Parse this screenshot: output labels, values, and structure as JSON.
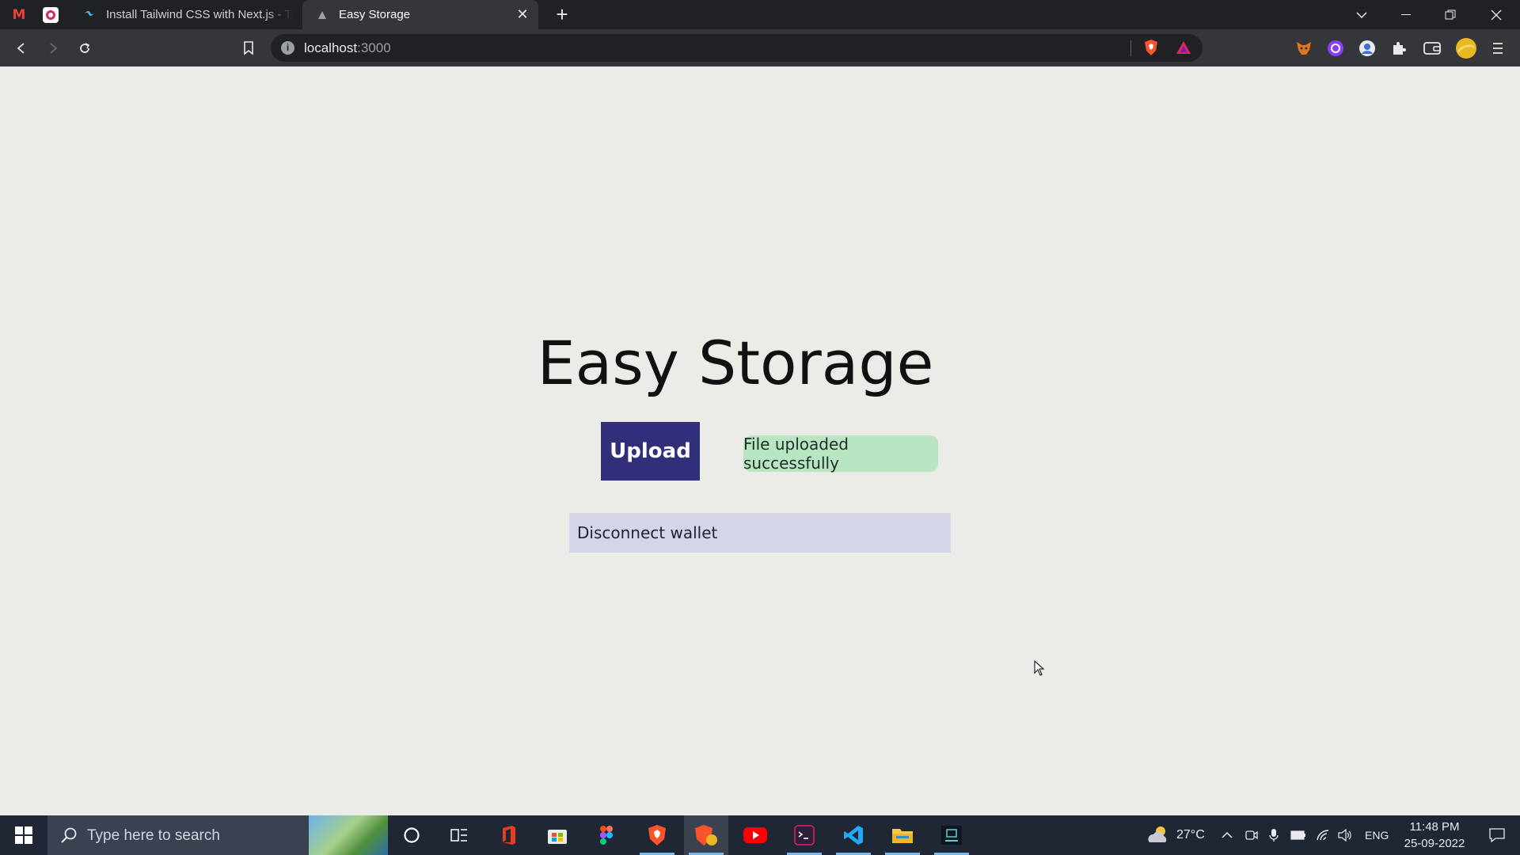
{
  "browser": {
    "tabs": [
      {
        "title": "Install Tailwind CSS with Next.js - Tailwind CSS",
        "active": false
      },
      {
        "title": "Easy Storage",
        "active": true
      }
    ],
    "url_host": "localhost",
    "url_port": ":3000"
  },
  "page": {
    "heading": "Easy Storage",
    "upload_label": "Upload",
    "status_message": "File uploaded successfully",
    "disconnect_label": "Disconnect wallet"
  },
  "taskbar": {
    "search_placeholder": "Type here to search",
    "weather_temp": "27°C",
    "language": "ENG",
    "time": "11:48 PM",
    "date": "25-09-2022"
  },
  "colors": {
    "upload_button": "#332e7a",
    "success_badge": "#b9e6c2",
    "disconnect_button": "#d3d6e6",
    "page_background": "#ebebe8"
  }
}
